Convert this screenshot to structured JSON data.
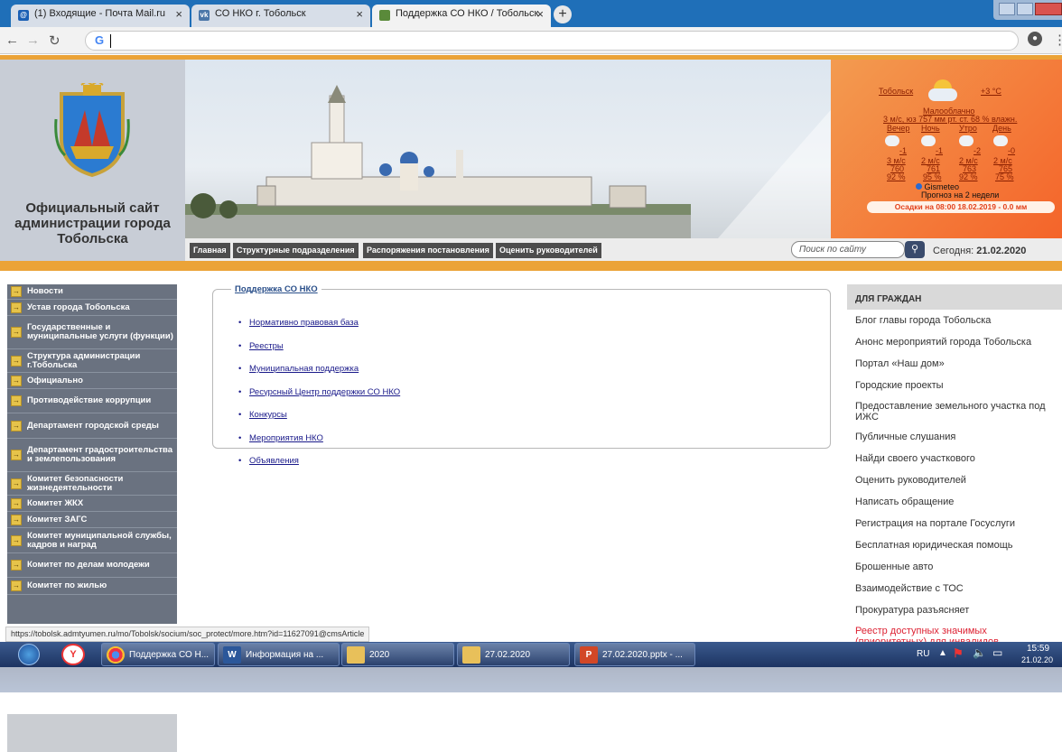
{
  "browser": {
    "tabs": [
      {
        "label": "(1) Входящие - Почта Mail.ru",
        "favicon": "mail-icon",
        "color": "#1a5fb4"
      },
      {
        "label": "СО НКО г. Тобольск",
        "favicon": "vk-icon",
        "color": "#4a76a8"
      },
      {
        "label": "Поддержка СО НКО / Тобольск",
        "favicon": "site-icon",
        "color": "#5a8a3a"
      }
    ],
    "new_tab": "+",
    "omnibox_value": "",
    "omnibox_icon": "G"
  },
  "header": {
    "site_title": "Официальный сайт администрации города Тобольска",
    "weather": {
      "city": "Тобольск",
      "temp": "+3 °C",
      "condition": "Малооблачно",
      "details": "3 м/с, юз 757 мм рт. ст. 68 % влажн.",
      "periods": [
        "Вечер",
        "Ночь",
        "Утро",
        "День"
      ],
      "temps": [
        "-1",
        "-1",
        "-2",
        "-0"
      ],
      "winds": [
        "3 м/с",
        "2 м/с",
        "2 м/с",
        "2 м/с"
      ],
      "pressures": [
        "760",
        "761",
        "763",
        "765"
      ],
      "humidity": [
        "92 %",
        "95 %",
        "92 %",
        "75 %"
      ],
      "source": "Gismeteo",
      "forecast_link": "Прогноз на 2 недели",
      "precip": "Осадки на 08:00 18.02.2019 - 0.0 мм"
    },
    "menu": [
      "Главная",
      "Структурные подразделения",
      "Распоряжения постановления",
      "Оценить руководителей"
    ],
    "search_placeholder": "Поиск по сайту",
    "today_label": "Сегодня:",
    "today_value": "21.02.2020"
  },
  "sidebar": [
    "Новости",
    "Устав города Тобольска",
    "Государственные и муниципальные услуги (функции)",
    "Структура администрации г.Тобольска",
    "Официально",
    "Противодействие коррупции",
    "Департамент городской среды",
    "Департамент градостроительства и землепользования",
    "Комитет безопасности жизнедеятельности",
    "Комитет ЖКХ",
    "Комитет ЗАГС",
    "Комитет муниципальной службы, кадров и наград",
    "Комитет по делам молодежи",
    "Комитет по жилью"
  ],
  "content": {
    "title": "Поддержка СО НКО",
    "links": [
      "Нормативно правовая база",
      "Реестры",
      "Муниципальная поддержка",
      "Ресурсный Центр поддержки СО НКО",
      "Конкурсы",
      "Мероприятия НКО",
      "Объявления"
    ]
  },
  "right": {
    "heading": "ДЛЯ ГРАЖДАН",
    "items": [
      "Блог главы города Тобольска",
      "Анонс мероприятий города Тобольска",
      "Портал «Наш дом»",
      "Городские проекты",
      "Предоставление земельного участка под ИЖС",
      "Публичные слушания",
      "Найди своего участкового",
      "Оценить руководителей",
      "Написать обращение",
      "Регистрация на портале Госуслуги",
      "Бесплатная юридическая помощь",
      "Брошенные авто",
      "Взаимодействие с ТОС",
      "Прокуратура разъясняет",
      "Реестр доступных значимых (приоритетных) для инвалидов"
    ]
  },
  "status_url": "https://tobolsk.admtyumen.ru/mo/Tobolsk/socium/soc_protect/more.htm?id=11627091@cmsArticle",
  "taskbar": {
    "tasks": [
      {
        "label": "Поддержка СО Н...",
        "icon": "chrome-icon"
      },
      {
        "label": "Информация на ...",
        "icon": "word-icon"
      },
      {
        "label": "2020",
        "icon": "folder-icon"
      },
      {
        "label": "27.02.2020",
        "icon": "folder-icon"
      },
      {
        "label": "27.02.2020.pptx - ...",
        "icon": "powerpoint-icon"
      }
    ],
    "lang": "RU",
    "time": "15:59",
    "date": "21.02.20"
  }
}
